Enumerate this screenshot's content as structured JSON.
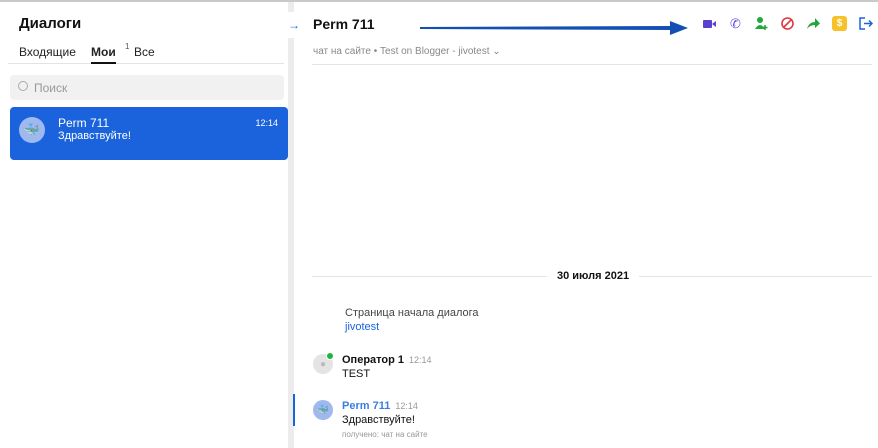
{
  "sidebar": {
    "title": "Диалоги",
    "tabs": [
      {
        "label": "Входящие"
      },
      {
        "label": "Мои",
        "badge": "1"
      },
      {
        "label": "Все"
      }
    ],
    "search_placeholder": "Поиск",
    "dialogs": [
      {
        "name": "Perm 711",
        "message": "Здравствуйте!",
        "time": "12:14"
      }
    ]
  },
  "header": {
    "name": "Perm 711",
    "subtitle": "чат на сайте • Test on Blogger - jivotest",
    "icons": [
      "video-icon",
      "phone-icon",
      "add-user-icon",
      "block-icon",
      "forward-icon",
      "payment-icon",
      "exit-icon"
    ]
  },
  "chat": {
    "date": "30 июля 2021",
    "start_label": "Страница начала диалога",
    "start_link": "jivotest",
    "messages": [
      {
        "author": "Оператор 1",
        "time": "12:14",
        "text": "TEST"
      },
      {
        "author": "Perm 711",
        "time": "12:14",
        "text": "Здравствуйте!",
        "meta": "получено: чат на сайте"
      }
    ]
  },
  "colors": {
    "accent": "#1a63dc"
  }
}
